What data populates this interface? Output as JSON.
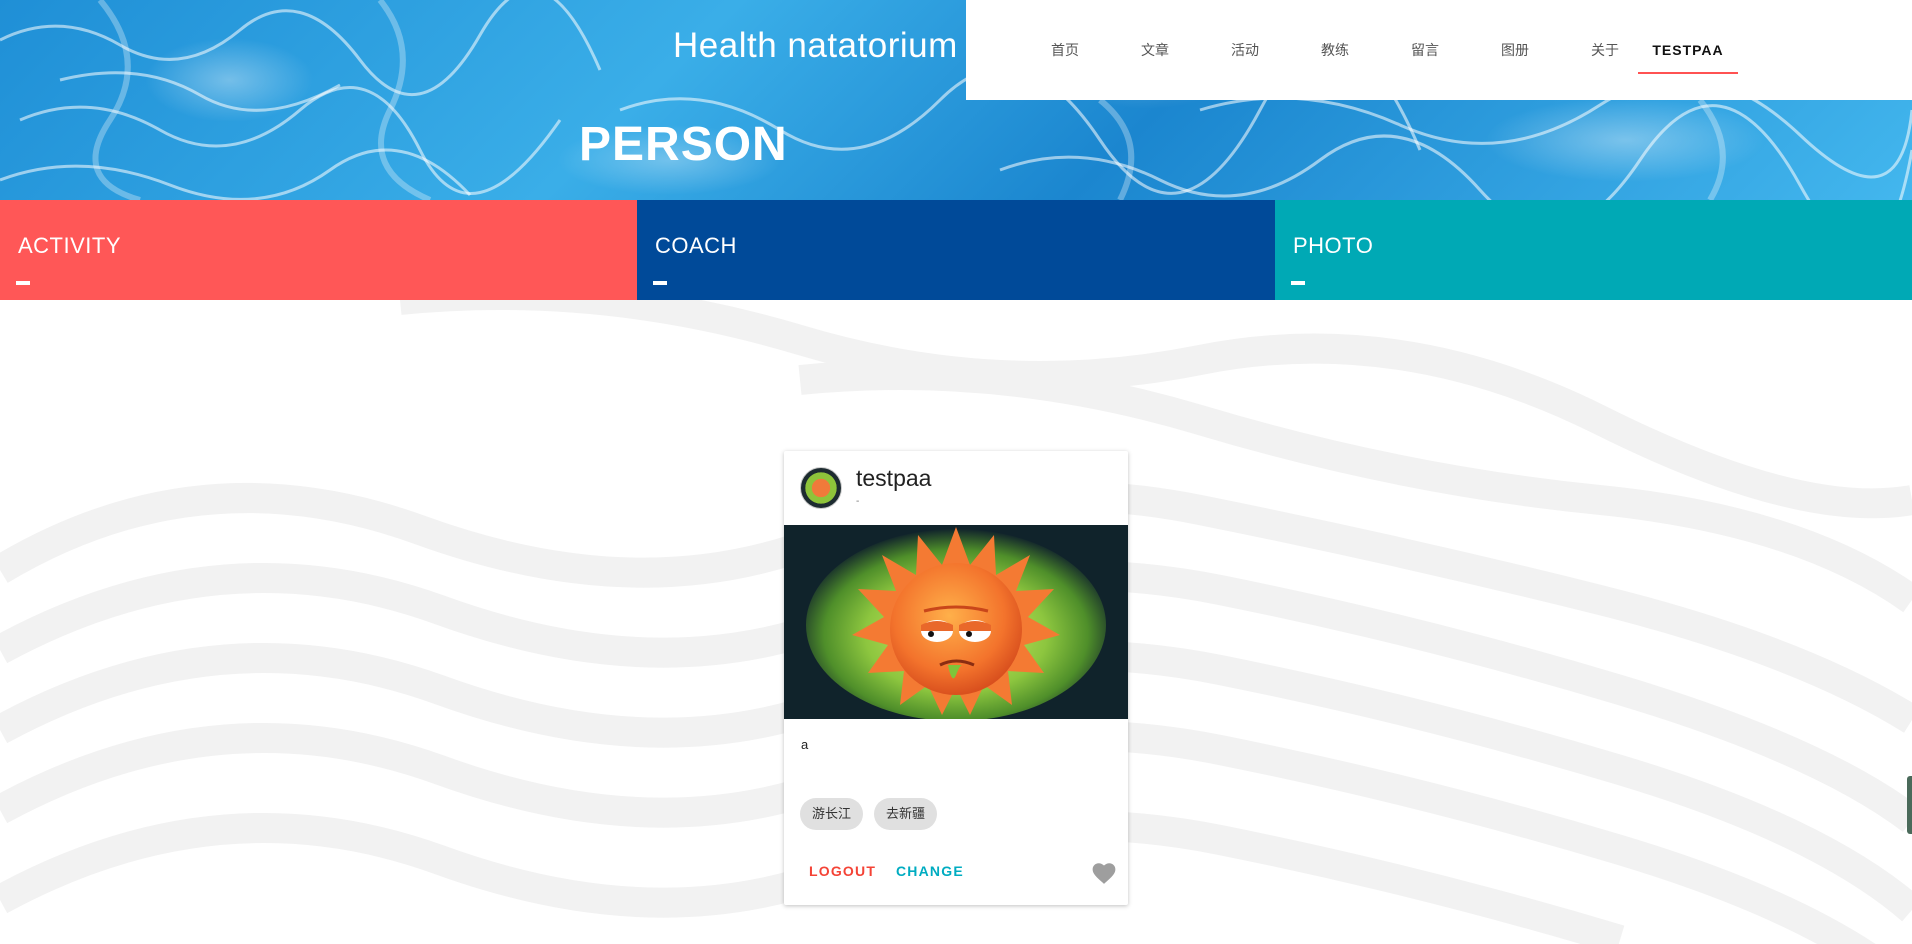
{
  "header": {
    "site_title": "Health natatorium",
    "page_heading": "PERSON"
  },
  "nav": {
    "items": [
      {
        "label": "首页"
      },
      {
        "label": "文章"
      },
      {
        "label": "活动"
      },
      {
        "label": "教练"
      },
      {
        "label": "留言"
      },
      {
        "label": "图册"
      },
      {
        "label": "关于"
      },
      {
        "label": "TESTPAA",
        "active": true
      }
    ],
    "active_color": "#ff5252"
  },
  "tiles": [
    {
      "label": "ACTIVITY",
      "color": "#ff5757"
    },
    {
      "label": "COACH",
      "color": "#004a99"
    },
    {
      "label": "PHOTO",
      "color": "#00a9b5"
    }
  ],
  "profile_card": {
    "username": "testpaa",
    "subtitle": "-",
    "description": "a",
    "tags": [
      "游长江",
      "去新疆"
    ],
    "logout_label": "LOGOUT",
    "change_label": "CHANGE",
    "logout_color": "#f44336",
    "change_color": "#00acc1",
    "favorite_icon": "heart-icon"
  }
}
